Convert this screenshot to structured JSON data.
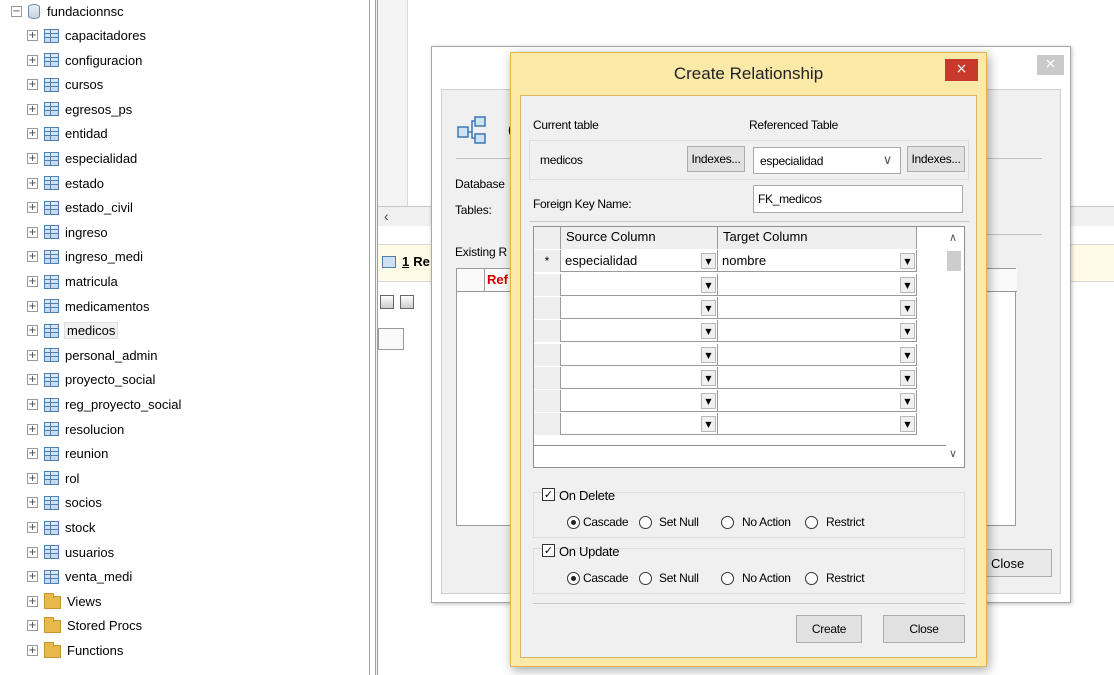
{
  "tree": {
    "database": "fundacionnsc",
    "tables": [
      "capacitadores",
      "configuracion",
      "cursos",
      "egresos_ps",
      "entidad",
      "especialidad",
      "estado",
      "estado_civil",
      "ingreso",
      "ingreso_medi",
      "matricula",
      "medicamentos",
      "medicos",
      "personal_admin",
      "proyecto_social",
      "reg_proyecto_social",
      "resolucion",
      "reunion",
      "rol",
      "socios",
      "stock",
      "usuarios",
      "venta_medi"
    ],
    "selected_table": "medicos",
    "folders": [
      "Views",
      "Stored Procs",
      "Functions"
    ]
  },
  "results": {
    "tab_number": "1",
    "tab_label": "Re",
    "grid_header": "Ref"
  },
  "back_dialog": {
    "close_glyph": "×",
    "header_initial": "(",
    "database_label": "Database",
    "tables_label": "Tables:",
    "existing_label": "Existing R",
    "close_button": "Close"
  },
  "dialog": {
    "title": "Create Relationship",
    "close_glyph": "×",
    "current_table_label": "Current table",
    "current_table_value": "medicos",
    "indexes_button": "Indexes...",
    "referenced_table_label": "Referenced Table",
    "referenced_table_value": "especialidad",
    "referenced_indexes_button": "Indexes...",
    "fk_name_label": "Foreign Key Name:",
    "fk_name_value": "FK_medicos",
    "grid": {
      "columns": [
        "Source Column",
        "Target Column"
      ],
      "rows": [
        {
          "marker": "*",
          "source": "especialidad",
          "target": "nombre"
        },
        {
          "marker": "",
          "source": "",
          "target": ""
        },
        {
          "marker": "",
          "source": "",
          "target": ""
        },
        {
          "marker": "",
          "source": "",
          "target": ""
        },
        {
          "marker": "",
          "source": "",
          "target": ""
        },
        {
          "marker": "",
          "source": "",
          "target": ""
        },
        {
          "marker": "",
          "source": "",
          "target": ""
        },
        {
          "marker": "",
          "source": "",
          "target": ""
        }
      ]
    },
    "on_delete": {
      "label": "On Delete",
      "checked": true,
      "options": [
        "Cascade",
        "Set Null",
        "No Action",
        "Restrict"
      ],
      "selected": "Cascade"
    },
    "on_update": {
      "label": "On Update",
      "checked": true,
      "options": [
        "Cascade",
        "Set Null",
        "No Action",
        "Restrict"
      ],
      "selected": "Cascade"
    },
    "create_button": "Create",
    "close_button": "Close"
  },
  "icons": {
    "expand": "plus-box",
    "collapse": "minus-box",
    "check": "✓",
    "dropdown": "▼",
    "chevron": "∨",
    "scroll_left": "‹"
  },
  "colors": {
    "dialog_frame": "#fbe9a8",
    "dialog_close": "#c8392b",
    "ref_header": "#d00000",
    "results_tab_bg": "#fffbe6"
  }
}
